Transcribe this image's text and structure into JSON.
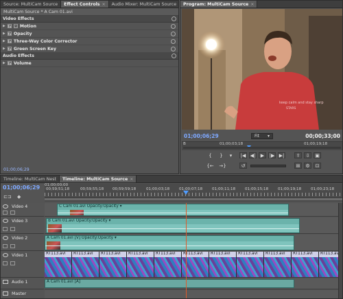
{
  "effect_controls": {
    "tabs": [
      {
        "label": "Source: MultiCam Source",
        "active": false
      },
      {
        "label": "Effect Controls",
        "active": true
      },
      {
        "label": "Audio Mixer: MultiCam Source",
        "active": false
      }
    ],
    "subtitle": "MultiCam Source * A Cam 01.avi",
    "video_section": "Video Effects",
    "video_effects": [
      "Motion",
      "Opacity",
      "Three-Way Color Corrector",
      "Green Screen Key"
    ],
    "audio_section": "Audio Effects",
    "audio_effects": [
      "Volume"
    ],
    "timecode": "01;00;06;29"
  },
  "program": {
    "tab": "Program: MultiCam Source",
    "timecode": "01;00;06;29",
    "fit": "Fit",
    "duration": "00;00;33;00",
    "ruler_labels": [
      "B",
      "01;00;03;18",
      "01;00;19;18"
    ],
    "shirt_text": "keep calm and stay sharp"
  },
  "timeline": {
    "tabs": [
      {
        "label": "Timeline: MultiCam Nest",
        "active": false
      },
      {
        "label": "Timeline: MultiCam Source",
        "active": true
      }
    ],
    "timecode": "01;00;06;29",
    "ruler_labels": [
      "01;00;00;00",
      "00;59;51;18",
      "00;59;55;18",
      "00;59;59;18",
      "01;00;03;18",
      "01;00;07;18",
      "01;00;11;18",
      "01;00;15;18",
      "01;00;19;18",
      "01;00;23;18"
    ],
    "tracks": {
      "video4": {
        "name": "Video 4",
        "clip": "C Cam 01.avi",
        "fx": "Opacity:Opacity"
      },
      "video3": {
        "name": "Video 3",
        "clip": "B Cam 01.avi",
        "fx": "Opacity:Opacity"
      },
      "video2": {
        "name": "Video 2",
        "clip": "A Cam 01.avi [V]",
        "fx": "Opacity:Opacity"
      },
      "video1": {
        "name": "Video 1",
        "clip": "RT113.avi"
      },
      "audio1": {
        "name": "Audio 1",
        "clip": "A Cam 01.avi [A]"
      },
      "master": {
        "name": "Master"
      }
    }
  }
}
